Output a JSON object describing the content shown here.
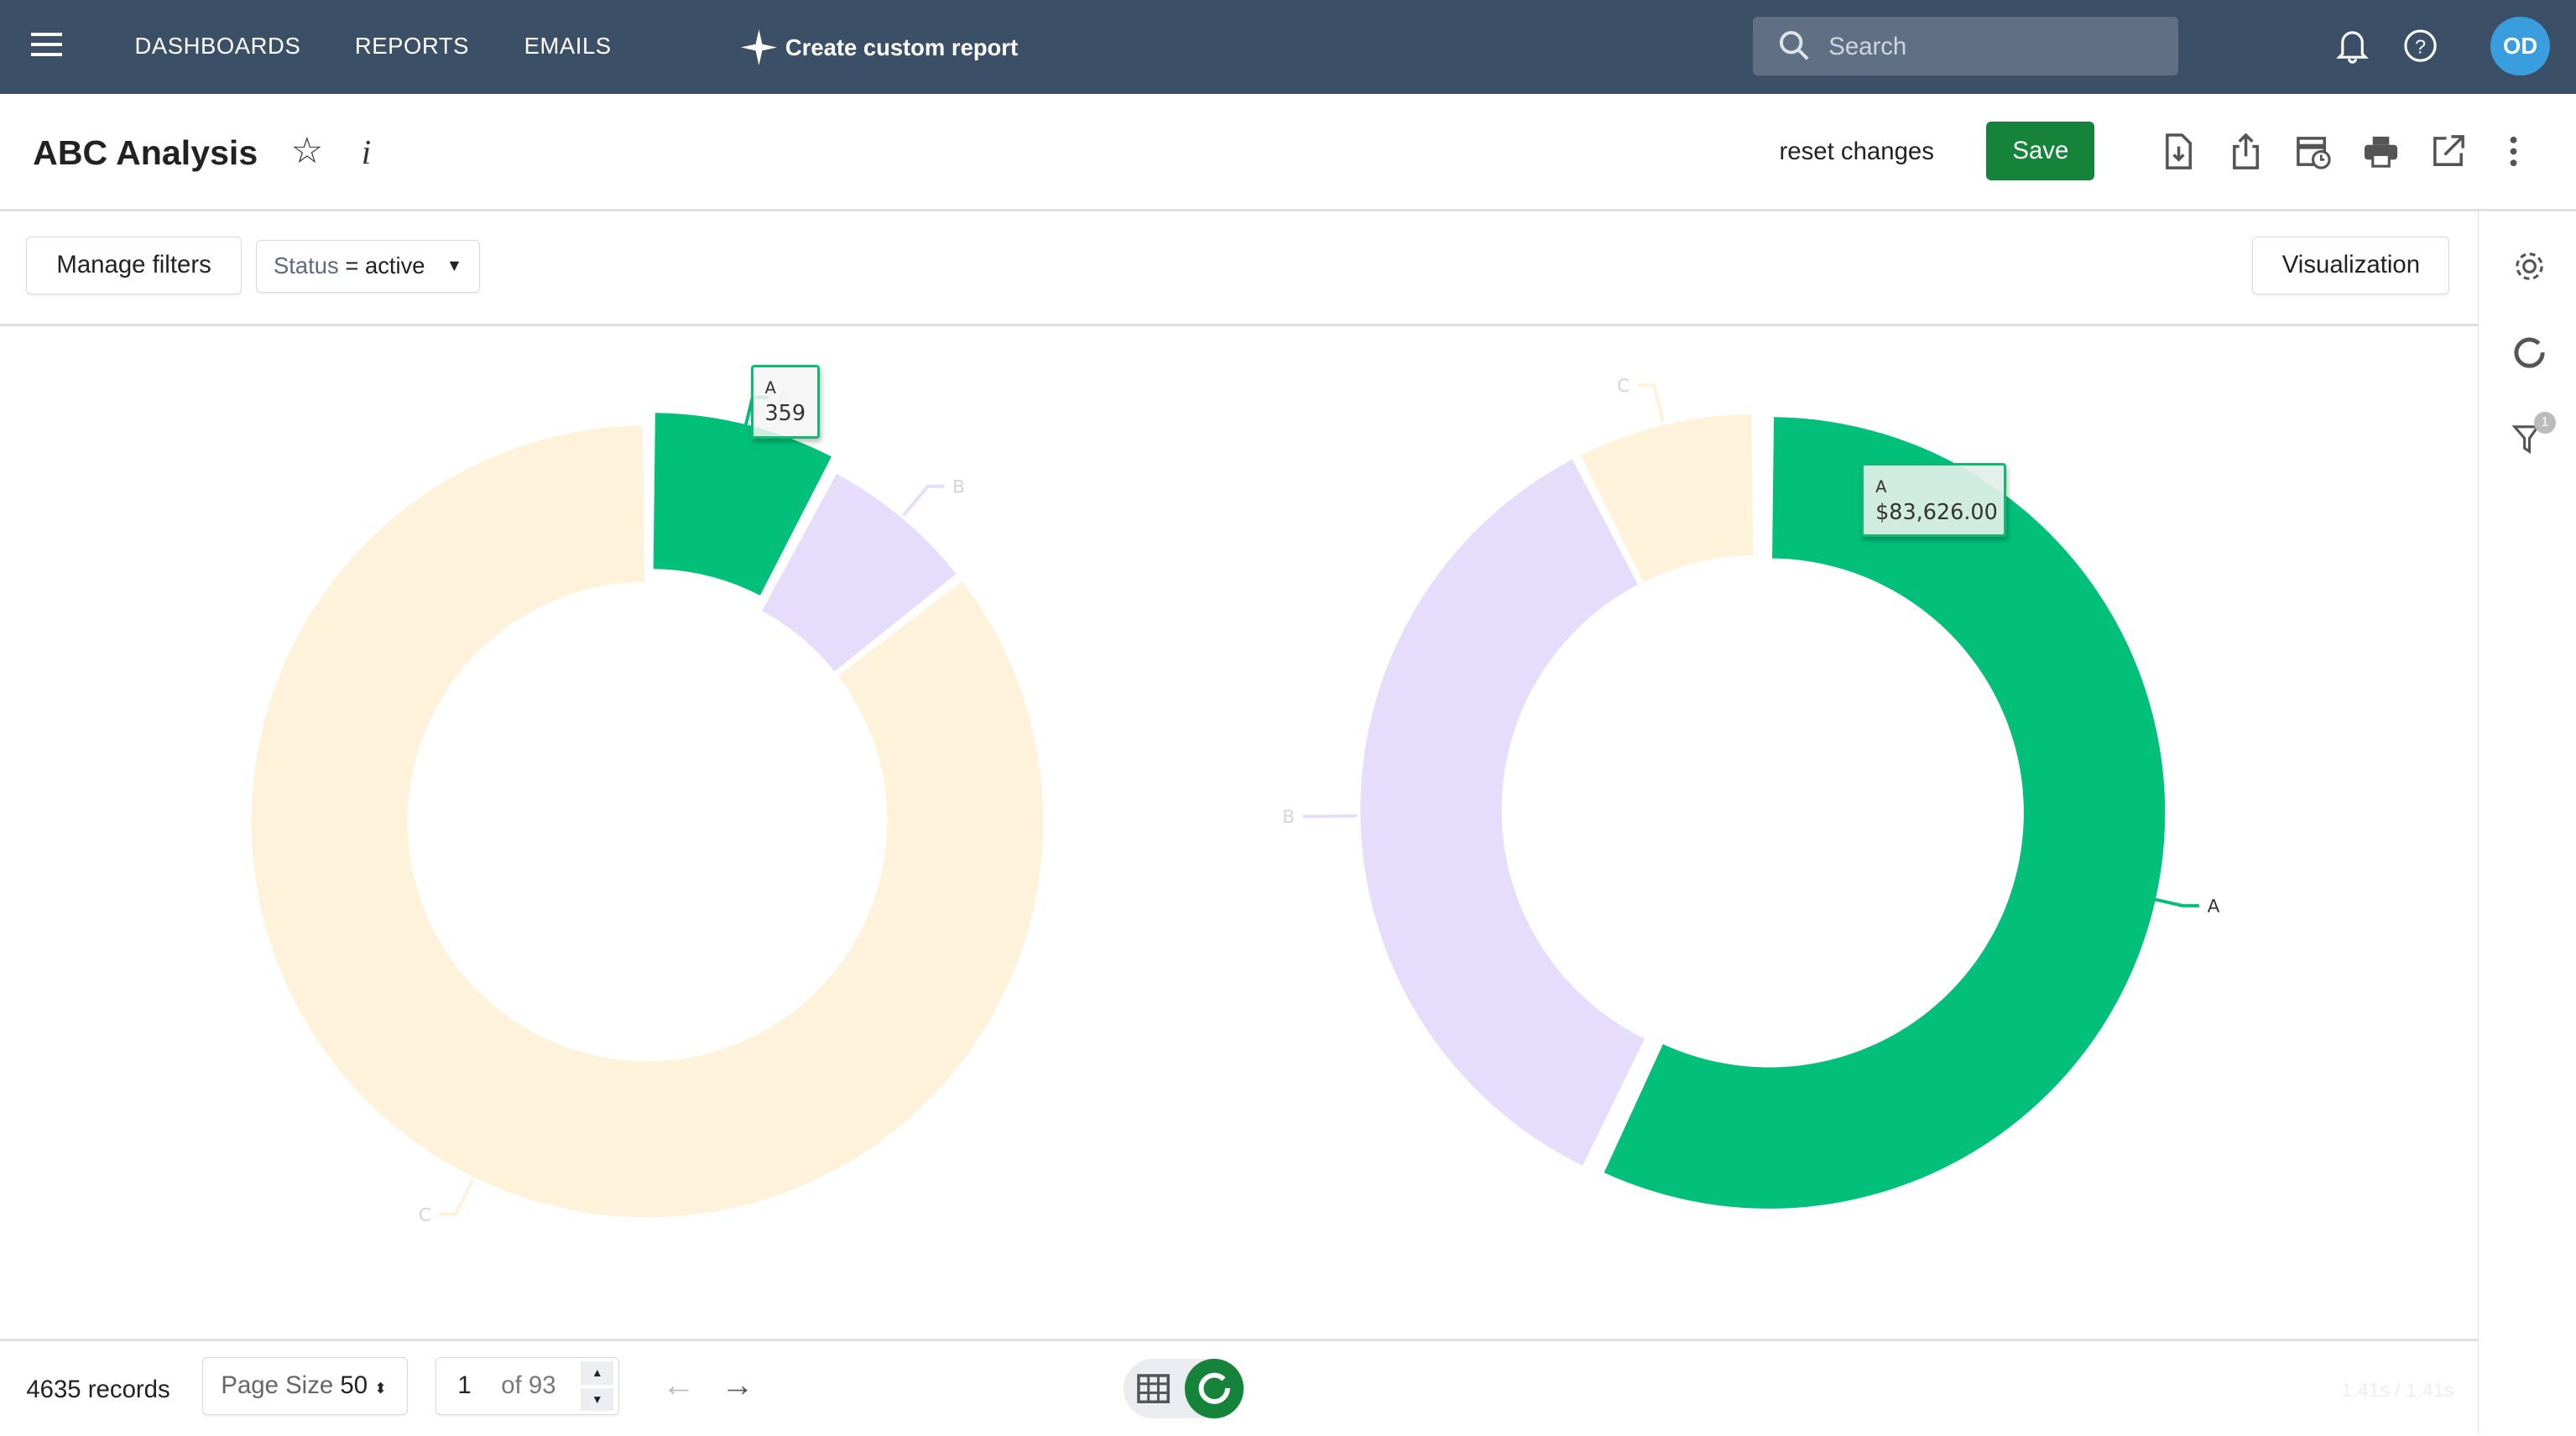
{
  "nav": {
    "items": [
      "DASHBOARDS",
      "REPORTS",
      "EMAILS"
    ],
    "create_label": "Create custom report",
    "search_placeholder": "Search",
    "avatar": "OD"
  },
  "header": {
    "title": "ABC Analysis",
    "reset_label": "reset changes",
    "save_label": "Save"
  },
  "filters": {
    "manage_label": "Manage filters",
    "status_field": "Status",
    "status_op": " = active",
    "visualization_label": "Visualization",
    "filter_badge": "1"
  },
  "footer": {
    "records": "4635 records",
    "page_size_label": "Page Size",
    "page_size": "50",
    "page": "1",
    "of_pages": "of 93",
    "timing": "1.41s / 1.41s"
  },
  "colors": {
    "A": "#02bf7a",
    "B": "#e6ddfc",
    "C": "#fef3da",
    "topbar": "#3b4f67",
    "save": "#16833a"
  },
  "chart_data": [
    {
      "type": "pie",
      "donut": true,
      "categories": [
        "A",
        "B",
        "C"
      ],
      "values": [
        359,
        310,
        3966
      ],
      "highlighted": "A",
      "tooltip": {
        "label": "A",
        "value": "359"
      }
    },
    {
      "type": "pie",
      "donut": true,
      "categories": [
        "A",
        "B",
        "C"
      ],
      "values": [
        83626,
        52000,
        11000
      ],
      "highlighted": "A",
      "tooltip": {
        "label": "A",
        "value": "$83,626.00"
      }
    }
  ]
}
